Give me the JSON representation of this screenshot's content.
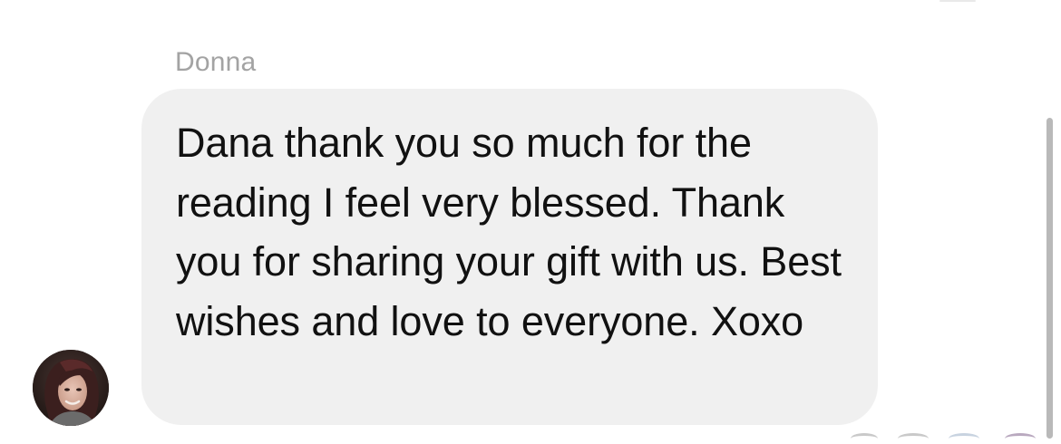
{
  "message": {
    "sender_name": "Donna",
    "text": "Dana thank you so much for the reading I feel very blessed. Thank you for sharing your gift with us. Best wishes and love to everyone. Xoxo"
  },
  "colors": {
    "background": "#ffffff",
    "bubble": "#f0f0f0",
    "message_text": "#111111",
    "sender_name_text": "#a3a3a3",
    "scrollbar": "#b9b9b9"
  },
  "icons": {
    "avatar": "profile-photo",
    "reactions": "reaction-avatars"
  }
}
